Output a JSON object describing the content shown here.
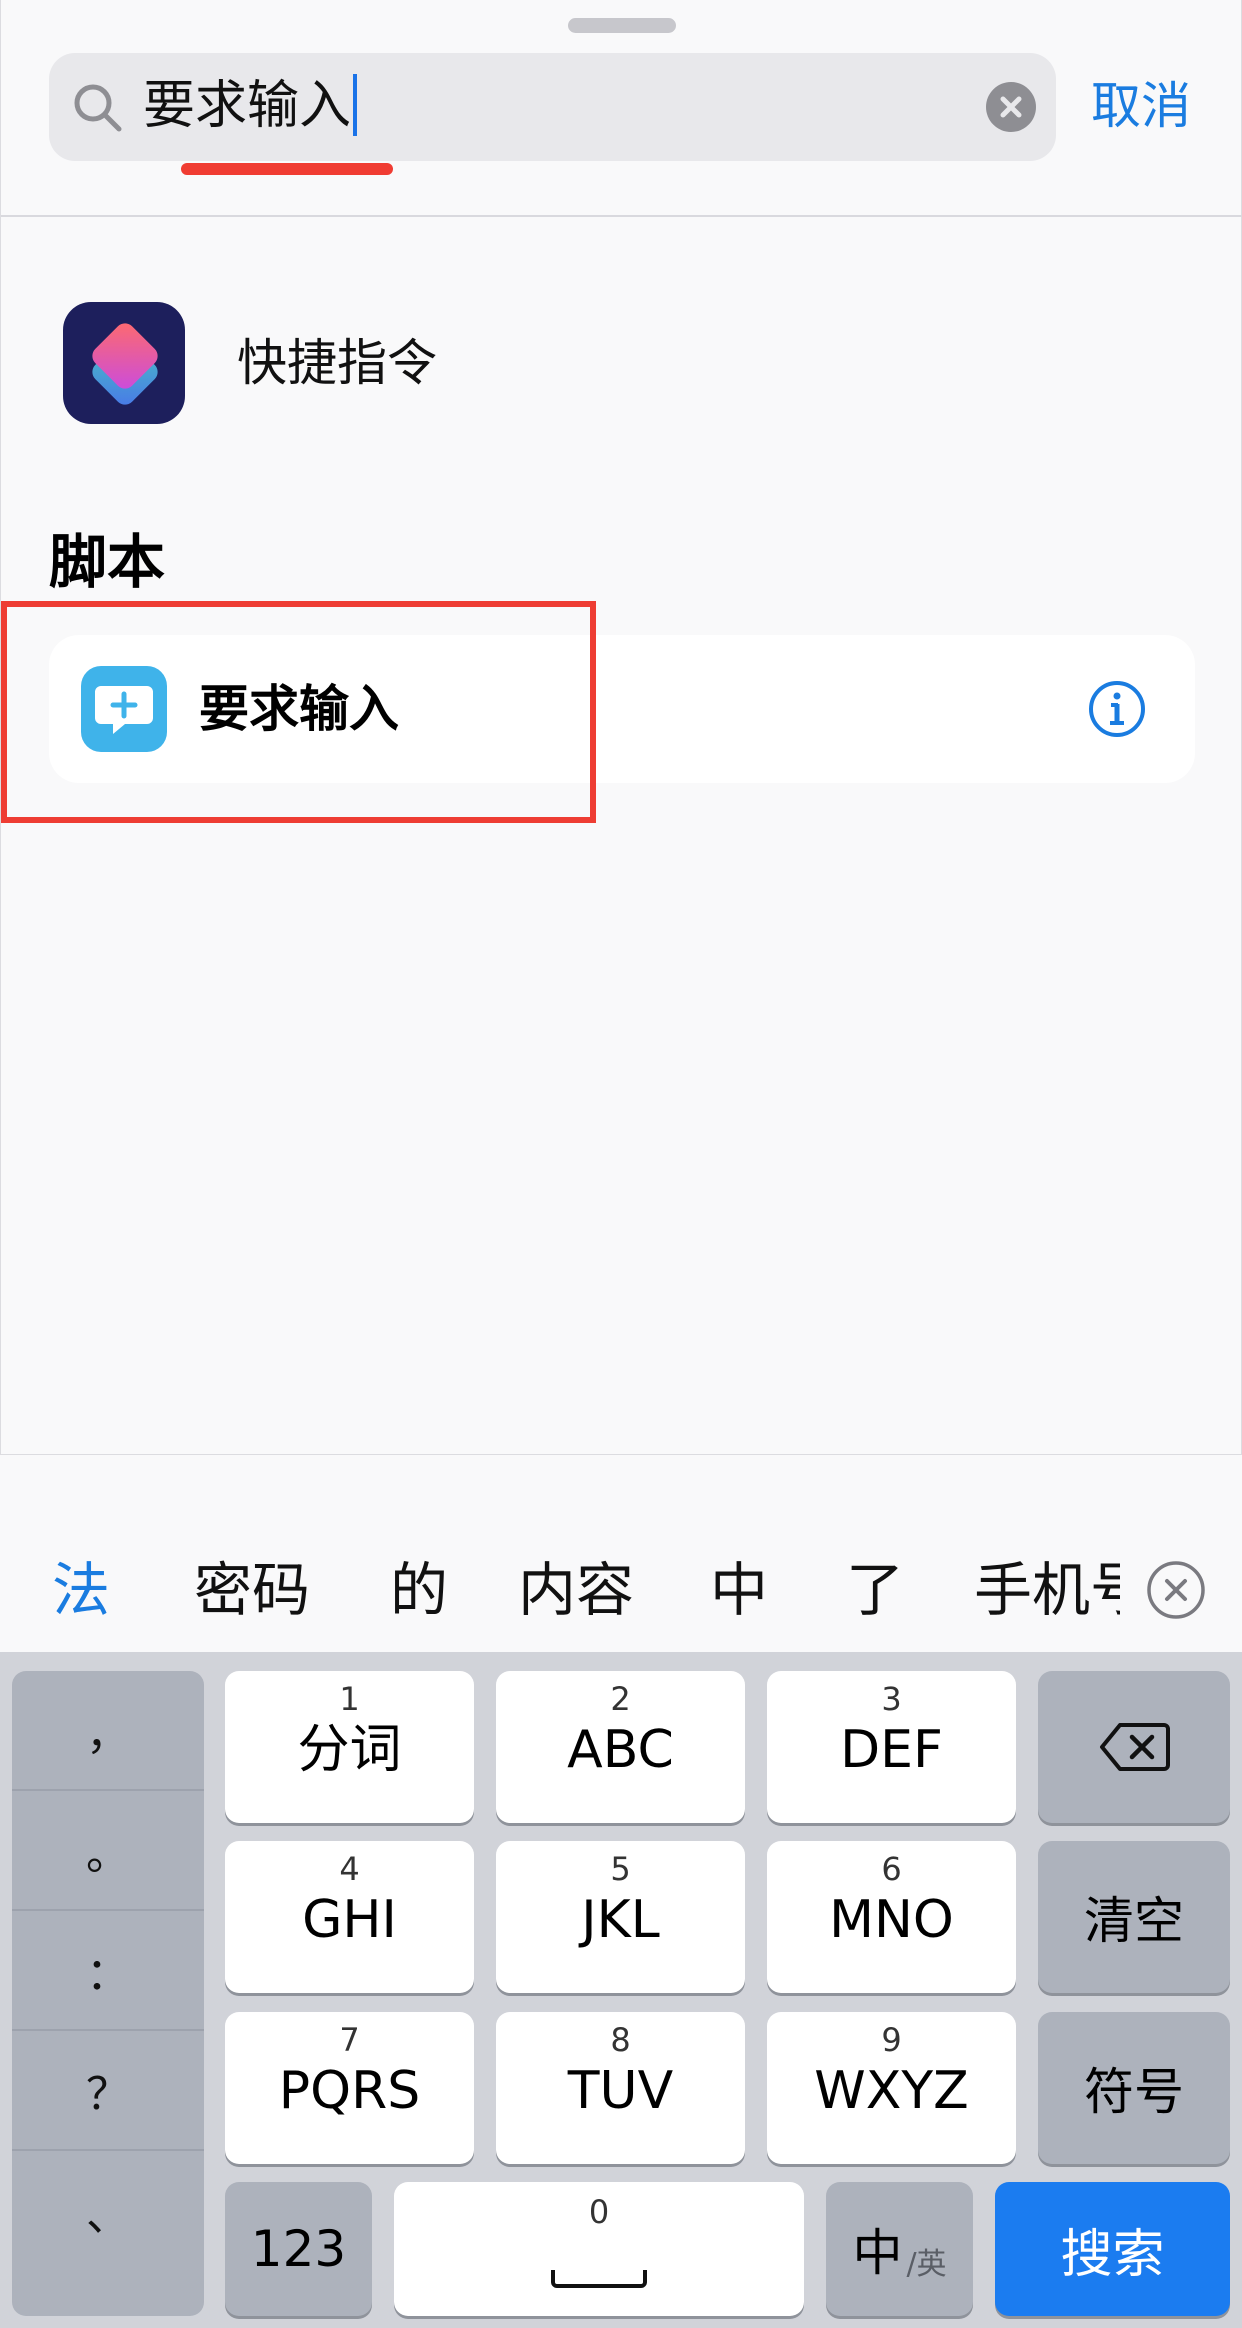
{
  "search": {
    "query": "要求输入",
    "cancel_label": "取消"
  },
  "app_result": {
    "label": "快捷指令",
    "icon": "shortcuts-app-icon"
  },
  "section": {
    "title": "脚本",
    "action_label": "要求输入",
    "action_icon": "speech-bubble-plus-icon",
    "info_icon": "info-icon"
  },
  "candidates": [
    "法",
    "密码",
    "的",
    "内容",
    "中",
    "了",
    "手机号"
  ],
  "keyboard": {
    "punctuation": [
      "，",
      "。",
      "：",
      "？",
      "、"
    ],
    "keys": [
      {
        "num": "1",
        "label": "分词"
      },
      {
        "num": "2",
        "label": "ABC"
      },
      {
        "num": "3",
        "label": "DEF"
      },
      {
        "num": "4",
        "label": "GHI"
      },
      {
        "num": "5",
        "label": "JKL"
      },
      {
        "num": "6",
        "label": "MNO"
      },
      {
        "num": "7",
        "label": "PQRS"
      },
      {
        "num": "8",
        "label": "TUV"
      },
      {
        "num": "9",
        "label": "WXYZ"
      }
    ],
    "clear_label": "清空",
    "symbols_label": "符号",
    "numbers_label": "123",
    "space_num": "0",
    "lang_main": "中",
    "lang_sub": "/英",
    "search_label": "搜索"
  },
  "colors": {
    "accent": "#1a7ce0",
    "highlight_red": "#ee3d33",
    "search_key": "#1b7cf0"
  }
}
